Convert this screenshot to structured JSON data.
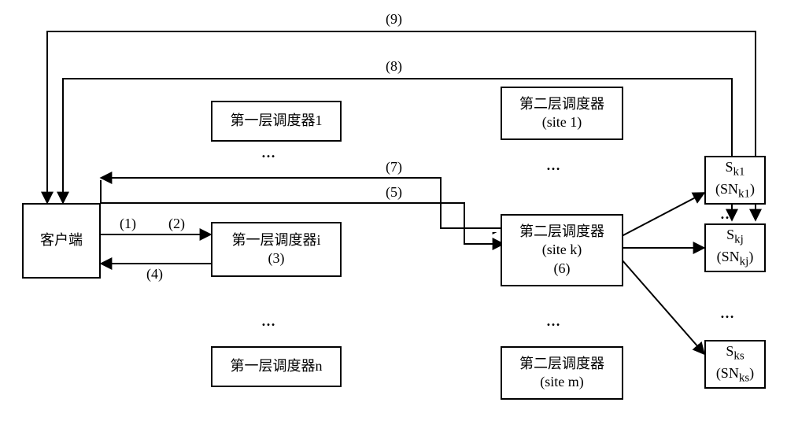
{
  "chart_data": {
    "type": "diagram",
    "title": "",
    "nodes": [
      {
        "id": "client",
        "pos": "left-middle",
        "label_lines": [
          "客户端"
        ]
      },
      {
        "id": "l1_1",
        "pos": "center-top",
        "label_lines": [
          "第一层调度器1"
        ]
      },
      {
        "id": "l1_i",
        "pos": "center-middle",
        "label_lines": [
          "第一层调度器i",
          "(3)"
        ]
      },
      {
        "id": "l1_n",
        "pos": "center-bottom",
        "label_lines": [
          "第一层调度器n"
        ]
      },
      {
        "id": "l2_1",
        "pos": "right-top",
        "label_lines": [
          "第二层调度器",
          "(site 1)"
        ]
      },
      {
        "id": "l2_k",
        "pos": "right-middle",
        "label_lines": [
          "第二层调度器",
          "(site k)",
          "(6)"
        ]
      },
      {
        "id": "l2_m",
        "pos": "right-bottom",
        "label_lines": [
          "第二层调度器",
          "(site m)"
        ]
      },
      {
        "id": "sk1",
        "pos": "far-right-top",
        "label_lines": [
          "S",
          "(SN",
          ")"
        ],
        "sub1": "k1",
        "sub2": "k1"
      },
      {
        "id": "skj",
        "pos": "far-right-middle",
        "label_lines": [
          "S",
          "(SN",
          ")"
        ],
        "sub1": "kj",
        "sub2": "kj"
      },
      {
        "id": "sks",
        "pos": "far-right-bottom",
        "label_lines": [
          "S",
          "(SN",
          ")"
        ],
        "sub1": "ks",
        "sub2": "ks"
      }
    ],
    "arrows": [
      {
        "id": 1,
        "label": "(1)",
        "from": "client",
        "to": "l1_i",
        "path": "client→l1_i upper forward segment 1"
      },
      {
        "id": 2,
        "label": "(2)",
        "from": "client",
        "to": "l1_i",
        "path": "client→l1_i upper forward segment 2"
      },
      {
        "id": 4,
        "label": "(4)",
        "from": "l1_i",
        "to": "client",
        "path": "l1_i→client lower return"
      },
      {
        "id": 5,
        "label": "(5)",
        "from": "client",
        "to": "l2_k",
        "path": "client→l2_k inner forward"
      },
      {
        "id": 7,
        "label": "(7)",
        "from": "l2_k",
        "to": "client",
        "path": "l2_k→client outer return"
      },
      {
        "id": 8,
        "label": "(8)",
        "from": "client",
        "to": "skj",
        "path": "client top loop 1 → skj"
      },
      {
        "id": 9,
        "label": "(9)",
        "from": "client",
        "to": "skj",
        "path": "client top loop 2 → skj"
      },
      {
        "id": "k-sk1",
        "label": "",
        "from": "l2_k",
        "to": "sk1"
      },
      {
        "id": "k-skj",
        "label": "",
        "from": "l2_k",
        "to": "skj"
      },
      {
        "id": "k-sks",
        "label": "",
        "from": "l2_k",
        "to": "sks"
      }
    ]
  },
  "nodes": {
    "client": {
      "line1": "客户端"
    },
    "l1_1": {
      "line1": "第一层调度器1"
    },
    "l1_i": {
      "line1": "第一层调度器i",
      "line2": "(3)"
    },
    "l1_n": {
      "line1": "第一层调度器n"
    },
    "l2_1": {
      "line1": "第二层调度器",
      "line2": "(site 1)"
    },
    "l2_k": {
      "line1": "第二层调度器",
      "line2": "(site k)",
      "line3": "(6)"
    },
    "l2_m": {
      "line1": "第二层调度器",
      "line2": "(site m)"
    }
  },
  "snodes": {
    "sk1": {
      "S": "S",
      "sub": "k1",
      "SN": "(SN",
      "close": ")"
    },
    "skj": {
      "S": "S",
      "sub": "kj",
      "SN": "(SN",
      "close": ")"
    },
    "sks": {
      "S": "S",
      "sub": "ks",
      "SN": "(SN",
      "close": ")"
    }
  },
  "labels": {
    "a1": "(1)",
    "a2": "(2)",
    "a4": "(4)",
    "a5": "(5)",
    "a7": "(7)",
    "a8": "(8)",
    "a9": "(9)"
  },
  "dots": "…"
}
